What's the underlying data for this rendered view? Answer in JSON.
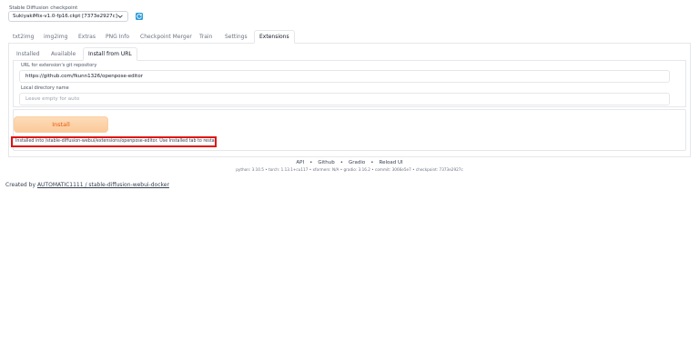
{
  "checkpoint": {
    "label": "Stable Diffusion checkpoint",
    "value": "SukiyakiMix-v1.0-fp16.ckpt [7373e2927c]"
  },
  "main_tabs": [
    "txt2img",
    "img2img",
    "Extras",
    "PNG Info",
    "Checkpoint Merger",
    "Train",
    "Settings",
    "Extensions"
  ],
  "extensions": {
    "sub_tabs": [
      "Installed",
      "Available",
      "Install from URL"
    ],
    "url_label": "URL for extension's git repository",
    "url_value": "https://github.com/fkunn1326/openpose-editor",
    "dir_label": "Local directory name",
    "dir_placeholder": "Leave empty for auto",
    "install_label": "Install",
    "result_text": "Installed into /stable-diffusion-webui/extensions/openpose-editor. Use Installed tab to restart."
  },
  "footer": {
    "links": [
      "API",
      "Github",
      "Gradio",
      "Reload UI"
    ],
    "versions": "python: 3.10.5  •  torch: 1.13.1+cu117  •  xformers: N/A  •  gradio: 3.16.2  •  commit: 3066e5e7  •  checkpoint: 7373e2927c",
    "created_by_prefix": "Created by",
    "created_by_link": "AUTOMATIC1111 / stable-diffusion-webui-docker"
  },
  "colors": {
    "accent_orange": "#ea580c",
    "install_button_bg": "#fbc99a",
    "highlight_red": "#e0140f",
    "refresh_blue": "#2d9cdb"
  },
  "icons": {
    "dropdown": "chevron-down-icon",
    "refresh": "refresh-icon"
  }
}
